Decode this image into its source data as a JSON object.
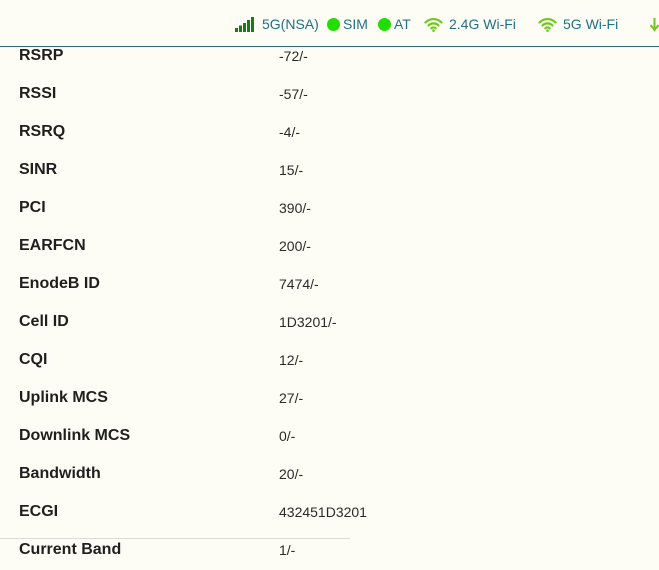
{
  "status": {
    "network": "5G(NSA)",
    "sim": "SIM",
    "at": "AT",
    "wifi24": "2.4G Wi-Fi",
    "wifi5": "5G Wi-Fi",
    "colors": {
      "text": "#1f7184",
      "signal": "#1a7a1a",
      "indicator": "#22dd00",
      "wifi": "#6dc81e"
    }
  },
  "rows": [
    {
      "label": "RSRP",
      "value": "-72/-"
    },
    {
      "label": "RSSI",
      "value": "-57/-"
    },
    {
      "label": "RSRQ",
      "value": "-4/-"
    },
    {
      "label": "SINR",
      "value": "15/-"
    },
    {
      "label": "PCI",
      "value": "390/-"
    },
    {
      "label": "EARFCN",
      "value": "200/-"
    },
    {
      "label": "EnodeB ID",
      "value": "7474/-"
    },
    {
      "label": "Cell ID",
      "value": "1D3201/-"
    },
    {
      "label": "CQI",
      "value": "12/-"
    },
    {
      "label": "Uplink MCS",
      "value": "27/-"
    },
    {
      "label": "Downlink MCS",
      "value": "0/-"
    },
    {
      "label": "Bandwidth",
      "value": "20/-"
    },
    {
      "label": "ECGI",
      "value": "432451D3201"
    },
    {
      "label": "Current Band",
      "value": "1/-"
    }
  ]
}
